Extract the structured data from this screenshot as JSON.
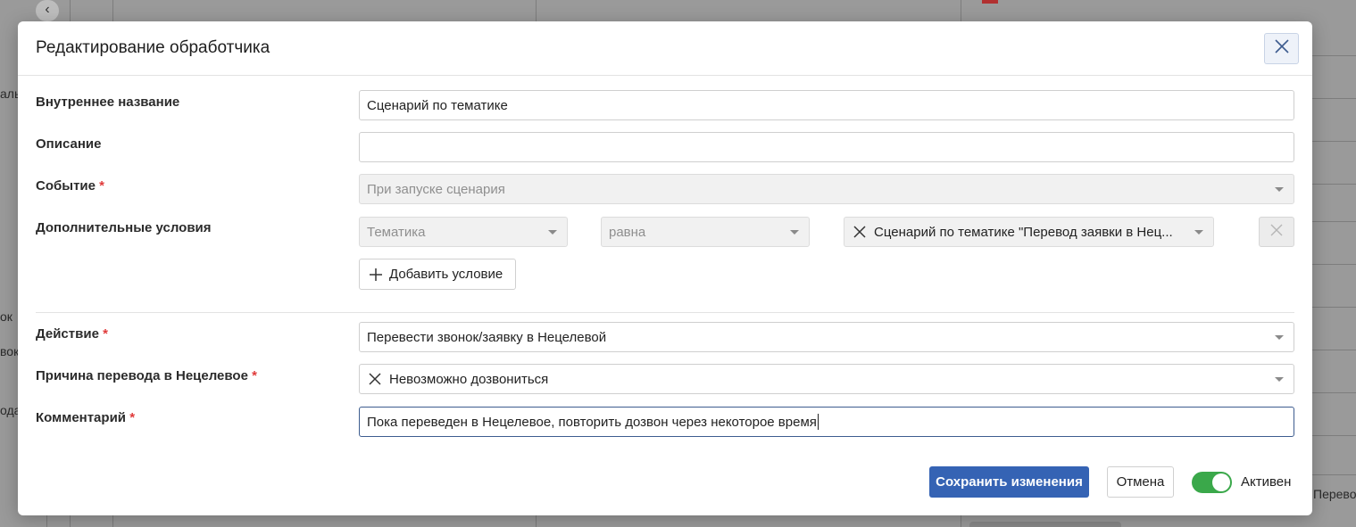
{
  "background": {
    "left_fragments": [
      "алы",
      "ок",
      "вок",
      "ода"
    ],
    "right_fragment": "Перево"
  },
  "modal": {
    "title": "Редактирование обработчика",
    "fields": {
      "internal_name": {
        "label": "Внутреннее название",
        "value": "Сценарий по тематике"
      },
      "description": {
        "label": "Описание",
        "value": ""
      },
      "event": {
        "label": "Событие",
        "required_mark": "*",
        "value": "При запуске сценария"
      },
      "extra_conditions": {
        "label": "Дополнительные условия",
        "condition_field": "Тематика",
        "operator": "равна",
        "condition_value": "Сценарий по тематике \"Перевод заявки в Нец...",
        "add_label": "Добавить условие"
      },
      "action": {
        "label": "Действие",
        "required_mark": "*",
        "value": "Перевести звонок/заявку в Нецелевой"
      },
      "reason": {
        "label": "Причина перевода в Нецелевое",
        "required_mark": "*",
        "value": "Невозможно дозвониться"
      },
      "comment": {
        "label": "Комментарий",
        "required_mark": "*",
        "value": "Пока переведен в Нецелевое, повторить дозвон через некоторое время"
      }
    },
    "footer": {
      "save_label": "Сохранить изменения",
      "cancel_label": "Отмена",
      "active_label": "Активен",
      "active": true
    }
  },
  "colors": {
    "primary": "#3563b4",
    "toggle_on": "#3aa84a",
    "required": "#e03a3a"
  }
}
